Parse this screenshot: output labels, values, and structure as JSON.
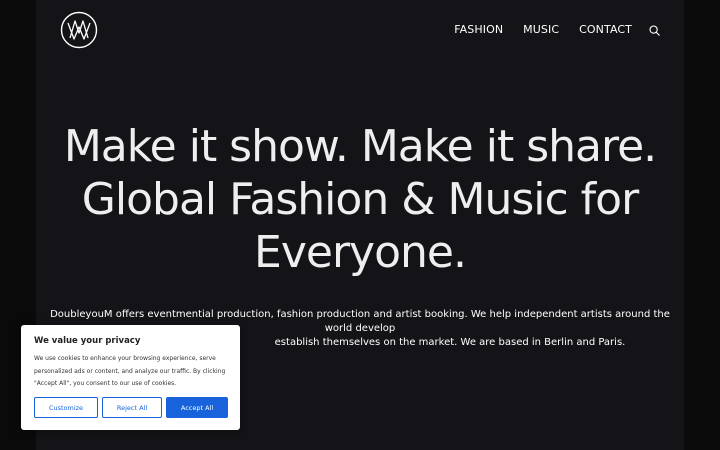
{
  "nav": {
    "items": [
      "FASHION",
      "MUSIC",
      "CONTACT"
    ]
  },
  "hero": {
    "headline_line1": "Make it show. Make it share.",
    "headline_line2": "Global Fashion & Music for",
    "headline_line3": "Everyone.",
    "description_line1": "DoubleyouM offers eventmential production, fashion production and artist booking. We help independent artists around the world develop",
    "description_line2": "establish themselves on the market. We are based in Berlin and Paris."
  },
  "cookie_banner": {
    "title": "We value your privacy",
    "text_line1": "We use cookies to enhance your browsing experience, serve",
    "text_line2": "personalized ads or content, and analyze our traffic. By clicking",
    "text_line3": "\"Accept All\", you consent to our use of cookies.",
    "customize_label": "Customize",
    "reject_label": "Reject All",
    "accept_label": "Accept All"
  },
  "colors": {
    "page_bg": "#141418",
    "outer_bg": "#0a0a0a",
    "accent_blue": "#1863dc",
    "text_light": "#eeeeee"
  },
  "icons": {
    "logo": "wm-monogram-logo",
    "search": "search-icon"
  }
}
